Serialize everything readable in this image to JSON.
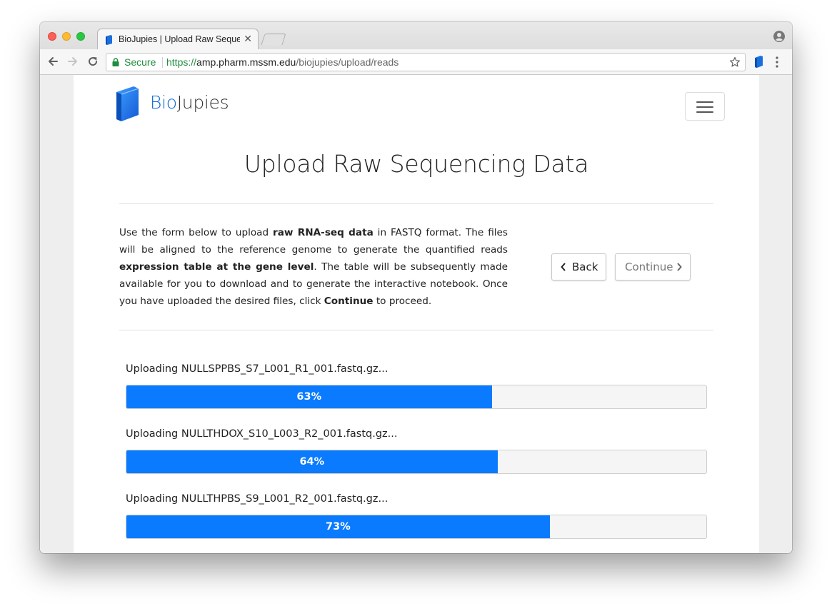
{
  "browser": {
    "tab_title": "BioJupies | Upload Raw Seque",
    "tab_close": "✕",
    "secure_label": "Secure",
    "url_scheme": "https://",
    "url_host": "amp.pharm.mssm.edu",
    "url_path": "/biojupies/upload/reads"
  },
  "header": {
    "brand_bio": "Bio",
    "brand_rest": "Jupies",
    "brand_color": "#0d66d0"
  },
  "main": {
    "title": "Upload Raw Sequencing Data",
    "intro": {
      "t1": "Use the form below to upload ",
      "b1": "raw RNA-seq data",
      "t2": " in FASTQ format. The files will be aligned to the reference genome to generate the quantified reads ",
      "b2": "expression table at the gene level",
      "t3": ". The table will be subsequently made available for you to download and to generate the interactive notebook. Once you have uploaded the desired files, click ",
      "b3": "Continue",
      "t4": " to proceed."
    },
    "back_label": "Back",
    "continue_label": "Continue"
  },
  "uploads": [
    {
      "label": "Uploading NULLSPPBS_S7_L001_R1_001.fastq.gz...",
      "percent_label": "63%",
      "progress": 0.63
    },
    {
      "label": "Uploading NULLTHDOX_S10_L003_R2_001.fastq.gz...",
      "percent_label": "64%",
      "progress": 0.64
    },
    {
      "label": "Uploading NULLTHPBS_S9_L001_R2_001.fastq.gz...",
      "percent_label": "73%",
      "progress": 0.73
    }
  ],
  "colors": {
    "progress_fill": "#0a7bff",
    "secure_green": "#1e8e3e"
  }
}
